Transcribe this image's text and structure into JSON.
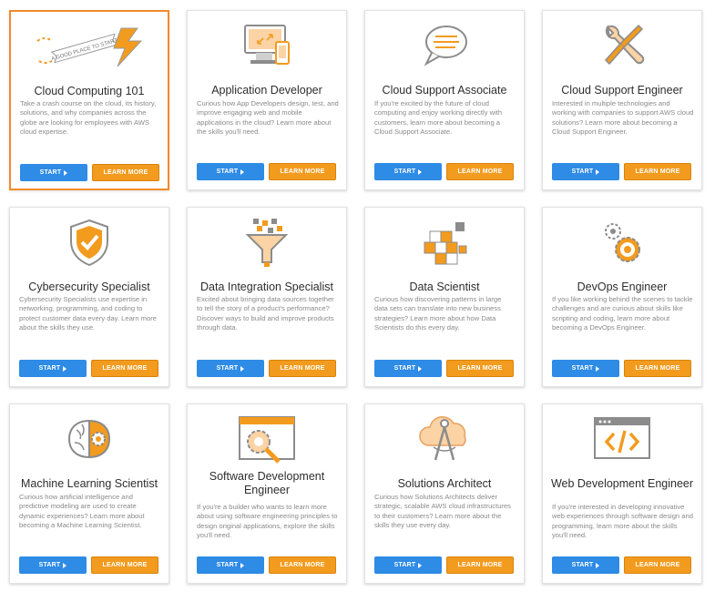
{
  "colors": {
    "accent_orange": "#f39b1e",
    "start_blue": "#2e8be6",
    "selected_border": "#f28a2e"
  },
  "buttons": {
    "start": "START",
    "learn_more": "LEARN MORE"
  },
  "banner_text": "A GOOD PLACE TO START!",
  "cards": [
    {
      "icon": "good-place-banner-icon",
      "title": "Cloud Computing 101",
      "desc": "Take a crash course on the cloud, its history, solutions, and why companies across the globe are looking for employees with AWS cloud expertise."
    },
    {
      "icon": "devices-icon",
      "title": "Application Developer",
      "desc": "Curious how App Developers design, test, and improve engaging web and mobile applications in the cloud? Learn more about the skills you'll need."
    },
    {
      "icon": "chat-bubble-icon",
      "title": "Cloud Support Associate",
      "desc": "If you're excited by the future of cloud computing and enjoy working directly with customers, learn more about becoming a Cloud Support Associate."
    },
    {
      "icon": "wrench-screwdriver-icon",
      "title": "Cloud Support Engineer",
      "desc": "Interested in multiple technologies and working with companies to support AWS cloud solutions? Learn more about becoming a Cloud Support Engineer."
    },
    {
      "icon": "shield-check-icon",
      "title": "Cybersecurity Specialist",
      "desc": "Cybersecurity Specialists use expertise in networking, programming, and coding to protect customer data every day. Learn more about the skills they use."
    },
    {
      "icon": "funnel-icon",
      "title": "Data Integration Specialist",
      "desc": "Excited about bringing data sources together to tell the story of a product's performance? Discover ways to build and improve products through data."
    },
    {
      "icon": "cubes-icon",
      "title": "Data Scientist",
      "desc": "Curious how discovering patterns in large data sets can translate into new business strategies? Learn more about how Data Scientists do this every day."
    },
    {
      "icon": "gears-icon",
      "title": "DevOps Engineer",
      "desc": "If you like working behind the scenes to tackle challenges and are curious about skills like scripting and coding, learn more about becoming a DevOps Engineer."
    },
    {
      "icon": "brain-gear-icon",
      "title": "Machine Learning Scientist",
      "desc": "Curious how artificial intelligence and predictive modeling are used to create dynamic experiences? Learn more about becoming a Machine Learning Scientist."
    },
    {
      "icon": "browser-gear-icon",
      "title": "Software Development Engineer",
      "desc": "If you're a builder who wants to learn more about using software engineering principles to design original applications, explore the skills you'll need."
    },
    {
      "icon": "cloud-compass-icon",
      "title": "Solutions Architect",
      "desc": "Curious how Solutions Architects deliver strategic, scalable AWS cloud infrastructures to their customers? Learn more about the skills they use every day."
    },
    {
      "icon": "code-window-icon",
      "title": "Web Development Engineer",
      "desc": "If you're interested in developing innovative web experiences through software design and programming, learn more about the skills you'll need."
    }
  ]
}
